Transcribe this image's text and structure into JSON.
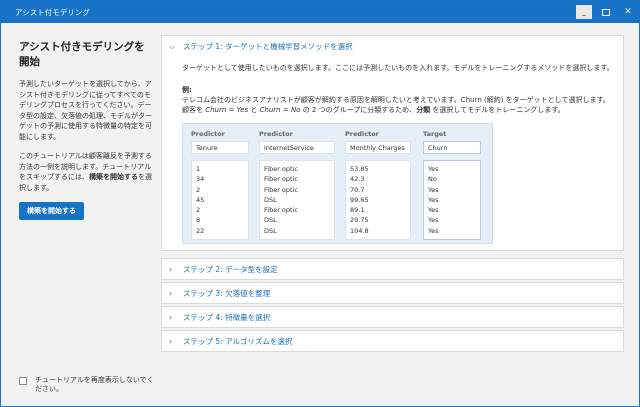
{
  "window": {
    "title": "アシスト付モデリング",
    "minimize": "_",
    "close": "✕"
  },
  "left": {
    "heading": "アシスト付きモデリングを開始",
    "para1": "予測したいターゲットを選択してから、アシスト付きモデリングに従ってすべてのモデリングプロセスを行ってください。データ型の設定、欠落値の処理、モデルがターゲットの予測に使用する特徴量の特定を可能にします。",
    "para2_a": "このチュートリアルは顧客離反を予測する方法の一例を説明します。チュートリアルをスキップするには、",
    "para2_b": "構築を開始する",
    "para2_c": "を選択します。",
    "start_button": "構築を開始する",
    "footer_checkbox_label": "チュートリアルを再度表示しないでください。"
  },
  "steps": [
    {
      "label": "ステップ 1: ターゲットと機械学習メソッドを選択",
      "expanded": true
    },
    {
      "label": "ステップ 2: データ型を設定",
      "expanded": false
    },
    {
      "label": "ステップ 3: 欠落値を整理",
      "expanded": false
    },
    {
      "label": "ステップ 4: 特徴量を選択",
      "expanded": false
    },
    {
      "label": "ステップ 5: アルゴリズムを選択",
      "expanded": false
    }
  ],
  "step1": {
    "description": "ターゲットとして使用したいものを選択します。ここには予測したいものを入れます。モデルをトレーニングするメソッドを選択します。",
    "example_label": "例:",
    "example_line1": "テレコム会社のビジネスアナリストが顧客が解約する原因を解明したいと考えています。Churn (解約) をターゲットとして選択します。",
    "example_line2_a": "顧客を ",
    "example_line2_b": "Churn = Yes",
    "example_line2_c": " と ",
    "example_line2_d": "Churn = No",
    "example_line2_e": " の 2 つのグループに分類するため、",
    "example_line2_f": "分類",
    "example_line2_g": " を選択してモデルをトレーニングします。",
    "columns": [
      {
        "role": "Predictor",
        "name": "Tenure",
        "values": [
          "1",
          "34",
          "2",
          "45",
          "2",
          "8",
          "22"
        ]
      },
      {
        "role": "Predictor",
        "name": "InternetService",
        "values": [
          "Fiber optic",
          "Fiber optic",
          "Fiber optic",
          "DSL",
          "Fiber optic",
          "DSL",
          "DSL"
        ]
      },
      {
        "role": "Predictor",
        "name": "Monthly Charges",
        "values": [
          "53.85",
          "42.3",
          "70.7",
          "99.65",
          "89.1",
          "29.75",
          "104.8"
        ]
      },
      {
        "role": "Target",
        "name": "Churn",
        "values": [
          "Yes",
          "No",
          "Yes",
          "Yes",
          "Yes",
          "Yes",
          "Yes"
        ]
      }
    ]
  }
}
